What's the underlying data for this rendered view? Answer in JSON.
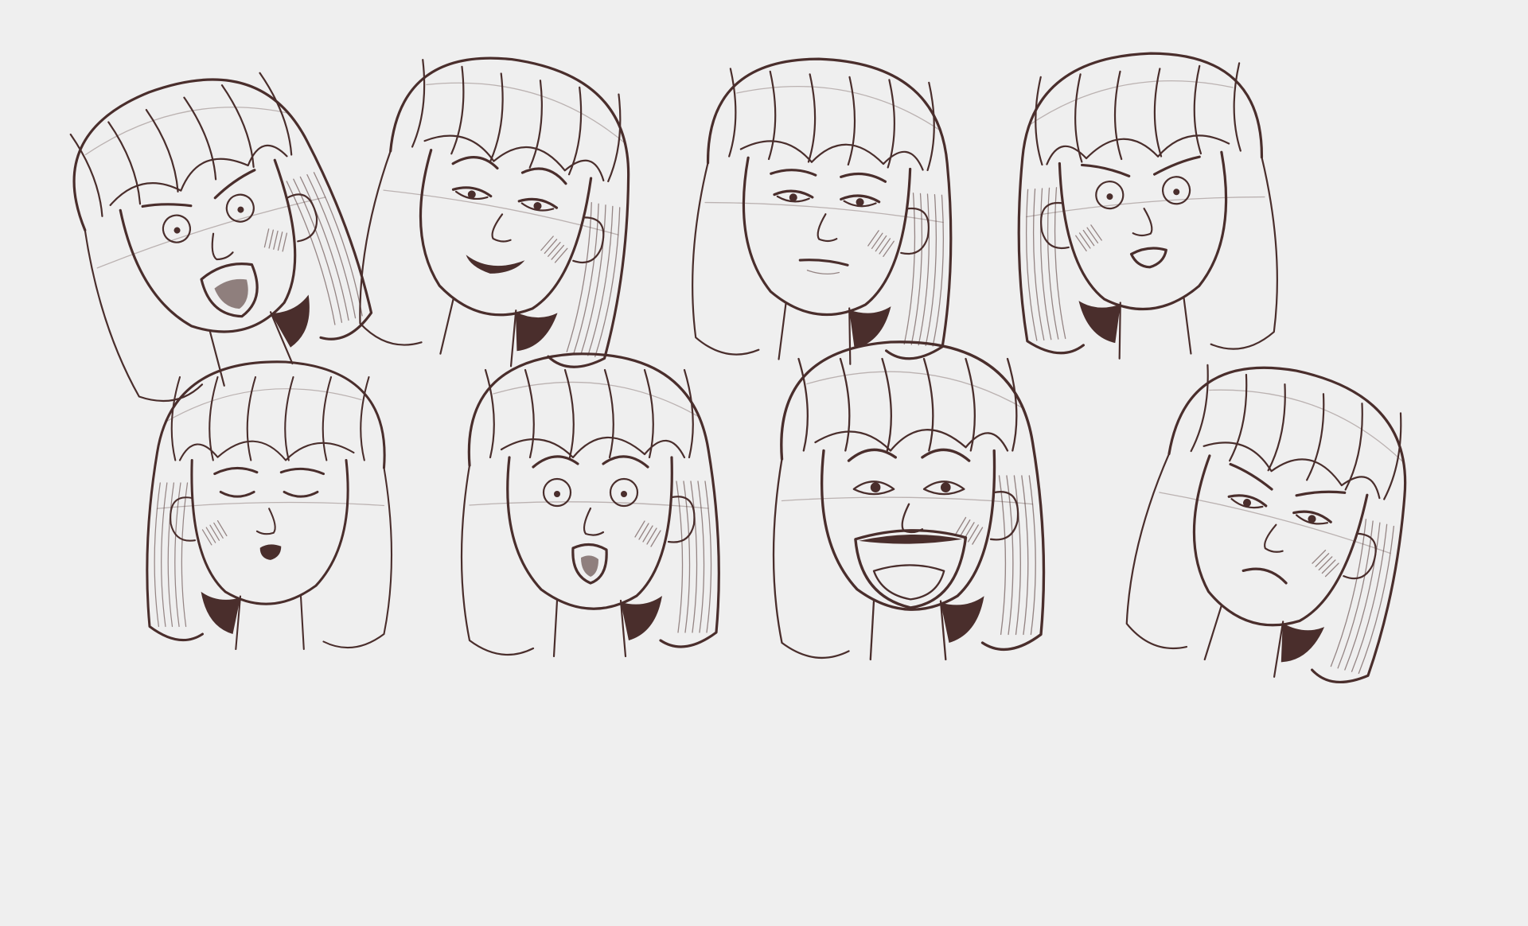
{
  "sheet": {
    "background": "#efefef",
    "ink_color": "#4a2e2c",
    "ink_light": "#8f7f7d"
  },
  "sketches": [
    {
      "expression": "shouting"
    },
    {
      "expression": "smirking"
    },
    {
      "expression": "unimpressed"
    },
    {
      "expression": "suspicious"
    },
    {
      "expression": "content-eyes-closed"
    },
    {
      "expression": "shocked"
    },
    {
      "expression": "laughing"
    },
    {
      "expression": "sulking"
    }
  ]
}
